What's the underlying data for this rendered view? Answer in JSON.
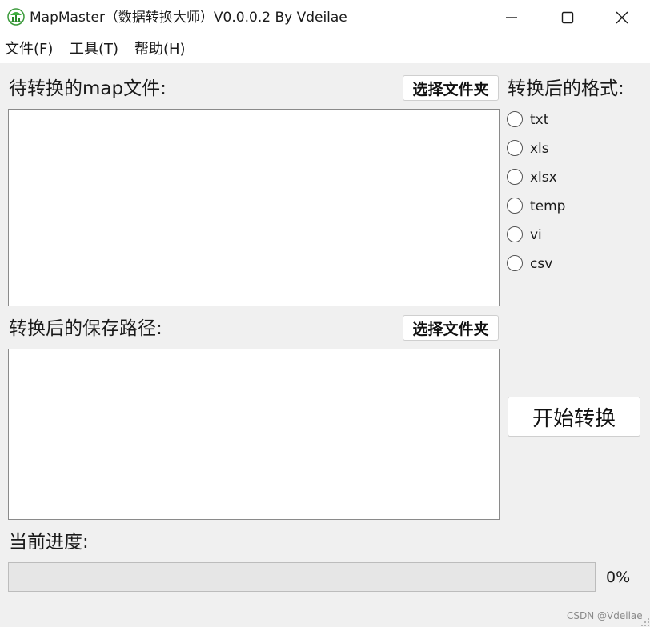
{
  "window": {
    "title": "MapMaster（数据转换大师）V0.0.0.2 By Vdeilae",
    "icon": "app-logo-icon"
  },
  "menu": {
    "items": [
      {
        "label": "文件(F)"
      },
      {
        "label": "工具(T)"
      },
      {
        "label": "帮助(H)"
      }
    ]
  },
  "source": {
    "label": "待转换的map文件:",
    "select_button": "选择文件夹",
    "value": ""
  },
  "target": {
    "label": "转换后的保存路径:",
    "select_button": "选择文件夹",
    "value": ""
  },
  "format": {
    "label": "转换后的格式:",
    "options": [
      "txt",
      "xls",
      "xlsx",
      "temp",
      "vi",
      "csv"
    ],
    "selected": null
  },
  "start_button": "开始转换",
  "progress": {
    "label": "当前进度:",
    "value_text": "0%",
    "fraction": 0
  },
  "watermark": "CSDN @Vdeilae",
  "colors": {
    "background": "#f0f0f0",
    "titlebar": "#ffffff",
    "progress_fill": "#06b025"
  }
}
